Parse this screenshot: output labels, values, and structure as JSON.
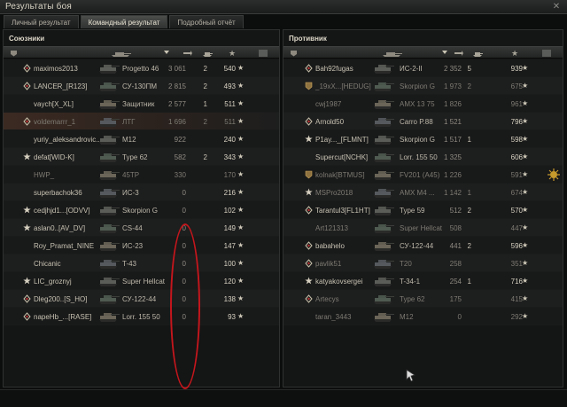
{
  "window": {
    "title": "Результаты боя",
    "close_label": "✕"
  },
  "tabs": [
    {
      "label": "Личный результат",
      "active": false
    },
    {
      "label": "Командный результат",
      "active": true
    },
    {
      "label": "Подробный отчёт",
      "active": false
    }
  ],
  "allies": {
    "title": "Союзники",
    "rows": [
      {
        "player": "maximos2013",
        "tank": "Progetto 46",
        "damage": "3 061",
        "frags": "2",
        "xp": "540",
        "dead": false,
        "self": false
      },
      {
        "player": "LANCER_[R123]",
        "tank": "СУ-130ПМ",
        "damage": "2 815",
        "frags": "2",
        "xp": "493",
        "dead": false,
        "self": false
      },
      {
        "player": "vaych[X_XL]",
        "tank": "Защитник",
        "damage": "2 577",
        "frags": "1",
        "xp": "511",
        "dead": false,
        "self": false
      },
      {
        "player": "voldemarrr_1",
        "tank": "ЛТГ",
        "damage": "1 696",
        "frags": "2",
        "xp": "511",
        "dead": true,
        "self": true
      },
      {
        "player": "yuriy_aleksandrovic...",
        "tank": "M12",
        "damage": "922",
        "frags": "",
        "xp": "240",
        "dead": false,
        "self": false
      },
      {
        "player": "defat[WID-K]",
        "tank": "Type 62",
        "damage": "582",
        "frags": "2",
        "xp": "343",
        "dead": false,
        "self": false
      },
      {
        "player": "HWP_",
        "tank": "45TP",
        "damage": "330",
        "frags": "",
        "xp": "170",
        "dead": true,
        "self": false
      },
      {
        "player": "superbachok36",
        "tank": "ИС-3",
        "damage": "0",
        "frags": "",
        "xp": "216",
        "dead": false,
        "self": false
      },
      {
        "player": "cedjhjd1...[ODVV]",
        "tank": "Skorpion G",
        "damage": "0",
        "frags": "",
        "xp": "102",
        "dead": false,
        "self": false
      },
      {
        "player": "aslan0..[AV_DV]",
        "tank": "CS-44",
        "damage": "0",
        "frags": "",
        "xp": "149",
        "dead": false,
        "self": false
      },
      {
        "player": "Roy_Pramat_NINE",
        "tank": "ИС-23",
        "damage": "0",
        "frags": "",
        "xp": "147",
        "dead": false,
        "self": false
      },
      {
        "player": "Chicanic",
        "tank": "T-43",
        "damage": "0",
        "frags": "",
        "xp": "100",
        "dead": false,
        "self": false
      },
      {
        "player": "LIC_groznyj",
        "tank": "Super Hellcat",
        "damage": "0",
        "frags": "",
        "xp": "120",
        "dead": false,
        "self": false
      },
      {
        "player": "Dleg200..[S_HO]",
        "tank": "СУ-122-44",
        "damage": "0",
        "frags": "",
        "xp": "138",
        "dead": false,
        "self": false
      },
      {
        "player": "napeHb_...[RASE]",
        "tank": "Lorr. 155 50",
        "damage": "0",
        "frags": "",
        "xp": "93",
        "dead": false,
        "self": false
      }
    ]
  },
  "enemies": {
    "title": "Противник",
    "rows": [
      {
        "player": "Bah92fugas",
        "tank": "ИС-2-II",
        "damage": "2 352",
        "frags": "5",
        "xp": "939",
        "dead": false
      },
      {
        "player": "_19xX...[HEDUG]",
        "tank": "Skorpion G",
        "damage": "1 973",
        "frags": "2",
        "xp": "675",
        "dead": true
      },
      {
        "player": "cwj1987",
        "tank": "AMX 13 75",
        "damage": "1 826",
        "frags": "",
        "xp": "961",
        "dead": true
      },
      {
        "player": "Arnold50",
        "tank": "Carro P.88",
        "damage": "1 521",
        "frags": "",
        "xp": "796",
        "dead": false
      },
      {
        "player": "P1ay..._[FLMNT]",
        "tank": "Skorpion G",
        "damage": "1 517",
        "frags": "1",
        "xp": "598",
        "dead": false
      },
      {
        "player": "Supercut[NCHK]",
        "tank": "Lorr. 155 50",
        "damage": "1 325",
        "frags": "",
        "xp": "606",
        "dead": false
      },
      {
        "player": "kolnak[BTMUS]",
        "tank": "FV201 (A45)",
        "damage": "1 226",
        "frags": "",
        "xp": "591",
        "dead": true
      },
      {
        "player": "MSPro2018",
        "tank": "AMX M4 ...",
        "damage": "1 142",
        "frags": "1",
        "xp": "674",
        "dead": true
      },
      {
        "player": "Tarantul3[FL1HT]",
        "tank": "Type 59",
        "damage": "512",
        "frags": "2",
        "xp": "570",
        "dead": false
      },
      {
        "player": "Art121313",
        "tank": "Super Hellcat",
        "damage": "508",
        "frags": "",
        "xp": "447",
        "dead": true
      },
      {
        "player": "babahelo",
        "tank": "СУ-122-44",
        "damage": "441",
        "frags": "2",
        "xp": "596",
        "dead": false
      },
      {
        "player": "pavlik51",
        "tank": "T20",
        "damage": "258",
        "frags": "",
        "xp": "351",
        "dead": true
      },
      {
        "player": "katyakovsergei",
        "tank": "T-34-1",
        "damage": "254",
        "frags": "1",
        "xp": "716",
        "dead": false
      },
      {
        "player": "Artecys",
        "tank": "Type 62",
        "damage": "175",
        "frags": "",
        "xp": "415",
        "dead": true
      },
      {
        "player": "taran_3443",
        "tank": "M12",
        "damage": "0",
        "frags": "",
        "xp": "292",
        "dead": true
      }
    ]
  },
  "colors": {
    "self_row": "#3b2a22",
    "annotation": "#c4161c",
    "medal": "#c79a2c"
  }
}
